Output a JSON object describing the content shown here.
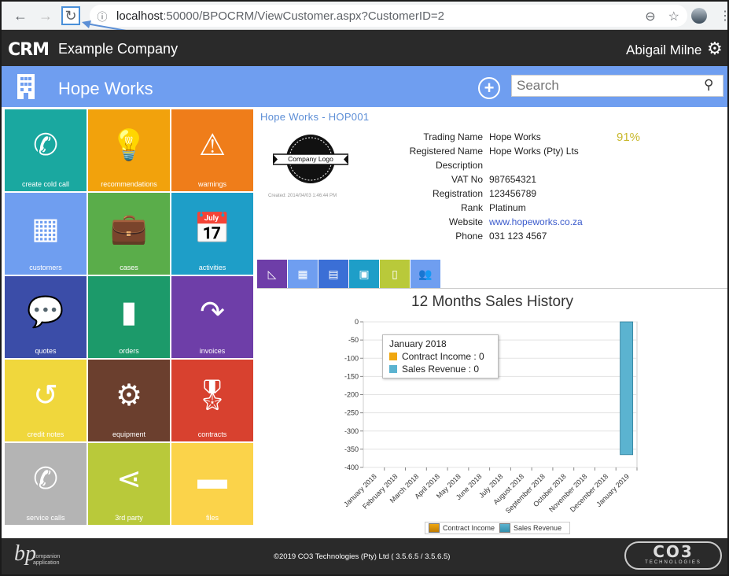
{
  "browser": {
    "url_host": "localhost",
    "url_path": ":50000/BPOCRM/ViewCustomer.aspx?CustomerID=2"
  },
  "app": {
    "logo": "CRM",
    "company": "Example Company",
    "user": "Abigail Milne"
  },
  "header": {
    "title": "Hope Works",
    "search_placeholder": "Search"
  },
  "tiles": [
    {
      "label": "create cold call",
      "icon": "phone-icon",
      "glyph": "✆",
      "color": "#1aa8a0"
    },
    {
      "label": "recommendations",
      "icon": "lightbulb-icon",
      "glyph": "💡",
      "color": "#f2a20c"
    },
    {
      "label": "warnings",
      "icon": "warning-icon",
      "glyph": "⚠",
      "color": "#ef7d1a"
    },
    {
      "label": "customers",
      "icon": "building-icon",
      "glyph": "▦",
      "color": "#6f9ef0"
    },
    {
      "label": "cases",
      "icon": "briefcase-icon",
      "glyph": "💼",
      "color": "#5aad4a"
    },
    {
      "label": "activities",
      "icon": "calendar-icon",
      "glyph": "📅",
      "color": "#1e9ec8"
    },
    {
      "label": "quotes",
      "icon": "chat-bubbles-icon",
      "glyph": "💬",
      "color": "#3b4da8"
    },
    {
      "label": "orders",
      "icon": "book-icon",
      "glyph": "▮",
      "color": "#1c9a6a"
    },
    {
      "label": "invoices",
      "icon": "redo-arrow-icon",
      "glyph": "↷",
      "color": "#6e3ea8"
    },
    {
      "label": "credit notes",
      "icon": "undo-icon",
      "glyph": "↺",
      "color": "#f0d73c"
    },
    {
      "label": "equipment",
      "icon": "gears-icon",
      "glyph": "⚙",
      "color": "#6b3f2e"
    },
    {
      "label": "contracts",
      "icon": "ribbon-icon",
      "glyph": "🎖",
      "color": "#d8412f"
    },
    {
      "label": "service calls",
      "icon": "phone-icon",
      "glyph": "✆",
      "color": "#b4b4b4"
    },
    {
      "label": "3rd party",
      "icon": "share-icon",
      "glyph": "⋖",
      "color": "#b9c93a"
    },
    {
      "label": "files",
      "icon": "folder-icon",
      "glyph": "▬",
      "color": "#fbd34a"
    }
  ],
  "customer": {
    "title": "Hope Works - HOP001",
    "logo_text": "Company Logo",
    "created": "Created: 2014/04/03 1:46:44 PM",
    "percent": "91%",
    "fields": [
      {
        "label": "Trading Name",
        "value": "Hope Works"
      },
      {
        "label": "Registered Name",
        "value": "Hope Works (Pty) Lts"
      },
      {
        "label": "Description",
        "value": ""
      },
      {
        "label": "VAT No",
        "value": "987654321"
      },
      {
        "label": "Registration",
        "value": "123456789"
      },
      {
        "label": "Rank",
        "value": "Platinum"
      },
      {
        "label": "Website",
        "value": "www.hopeworks.co.za"
      },
      {
        "label": "Phone",
        "value": "031 123 4567"
      }
    ]
  },
  "tabs": [
    {
      "icon": "area-chart-icon",
      "glyph": "◺",
      "color": "#6e3ea8"
    },
    {
      "icon": "building-icon",
      "glyph": "▦",
      "color": "#6f9ef0"
    },
    {
      "icon": "contacts-book-icon",
      "glyph": "▤",
      "color": "#3b6fd6"
    },
    {
      "icon": "calendar-icon",
      "glyph": "▣",
      "color": "#1e9ec8"
    },
    {
      "icon": "document-icon",
      "glyph": "▯",
      "color": "#b9c93a"
    },
    {
      "icon": "users-icon",
      "glyph": "👥",
      "color": "#6f9ef0"
    }
  ],
  "chart_data": {
    "type": "bar",
    "title": "12 Months Sales History",
    "categories": [
      "January 2018",
      "February 2018",
      "March 2018",
      "April 2018",
      "May 2018",
      "June 2018",
      "July 2018",
      "August 2018",
      "September 2018",
      "October 2018",
      "November 2018",
      "December 2018",
      "January 2019"
    ],
    "series": [
      {
        "name": "Contract Income",
        "values": [
          0,
          0,
          0,
          0,
          0,
          0,
          0,
          0,
          0,
          0,
          0,
          0,
          0
        ],
        "color": "#f0a70f"
      },
      {
        "name": "Sales Revenue",
        "values": [
          0,
          0,
          0,
          0,
          0,
          0,
          0,
          0,
          0,
          0,
          0,
          0,
          -365
        ],
        "color": "#5bb3d0"
      }
    ],
    "ylim": [
      -400,
      0
    ],
    "yticks": [
      0,
      -50,
      -100,
      -150,
      -200,
      -250,
      -300,
      -350,
      -400
    ],
    "grid": true,
    "legend": "bottom",
    "tooltip": {
      "title": "January 2018",
      "rows": [
        "Contract Income : 0",
        "Sales Revenue : 0"
      ]
    }
  },
  "footer": {
    "bp": "bp",
    "bp_sub1": "companion",
    "bp_sub2": "application",
    "copyright": "©2019 CO3 Technologies (Pty) Ltd ( 3.5.6.5 / 3.5.6.5)",
    "co3": "CO3",
    "co3_sub": "TECHNOLOGIES"
  }
}
